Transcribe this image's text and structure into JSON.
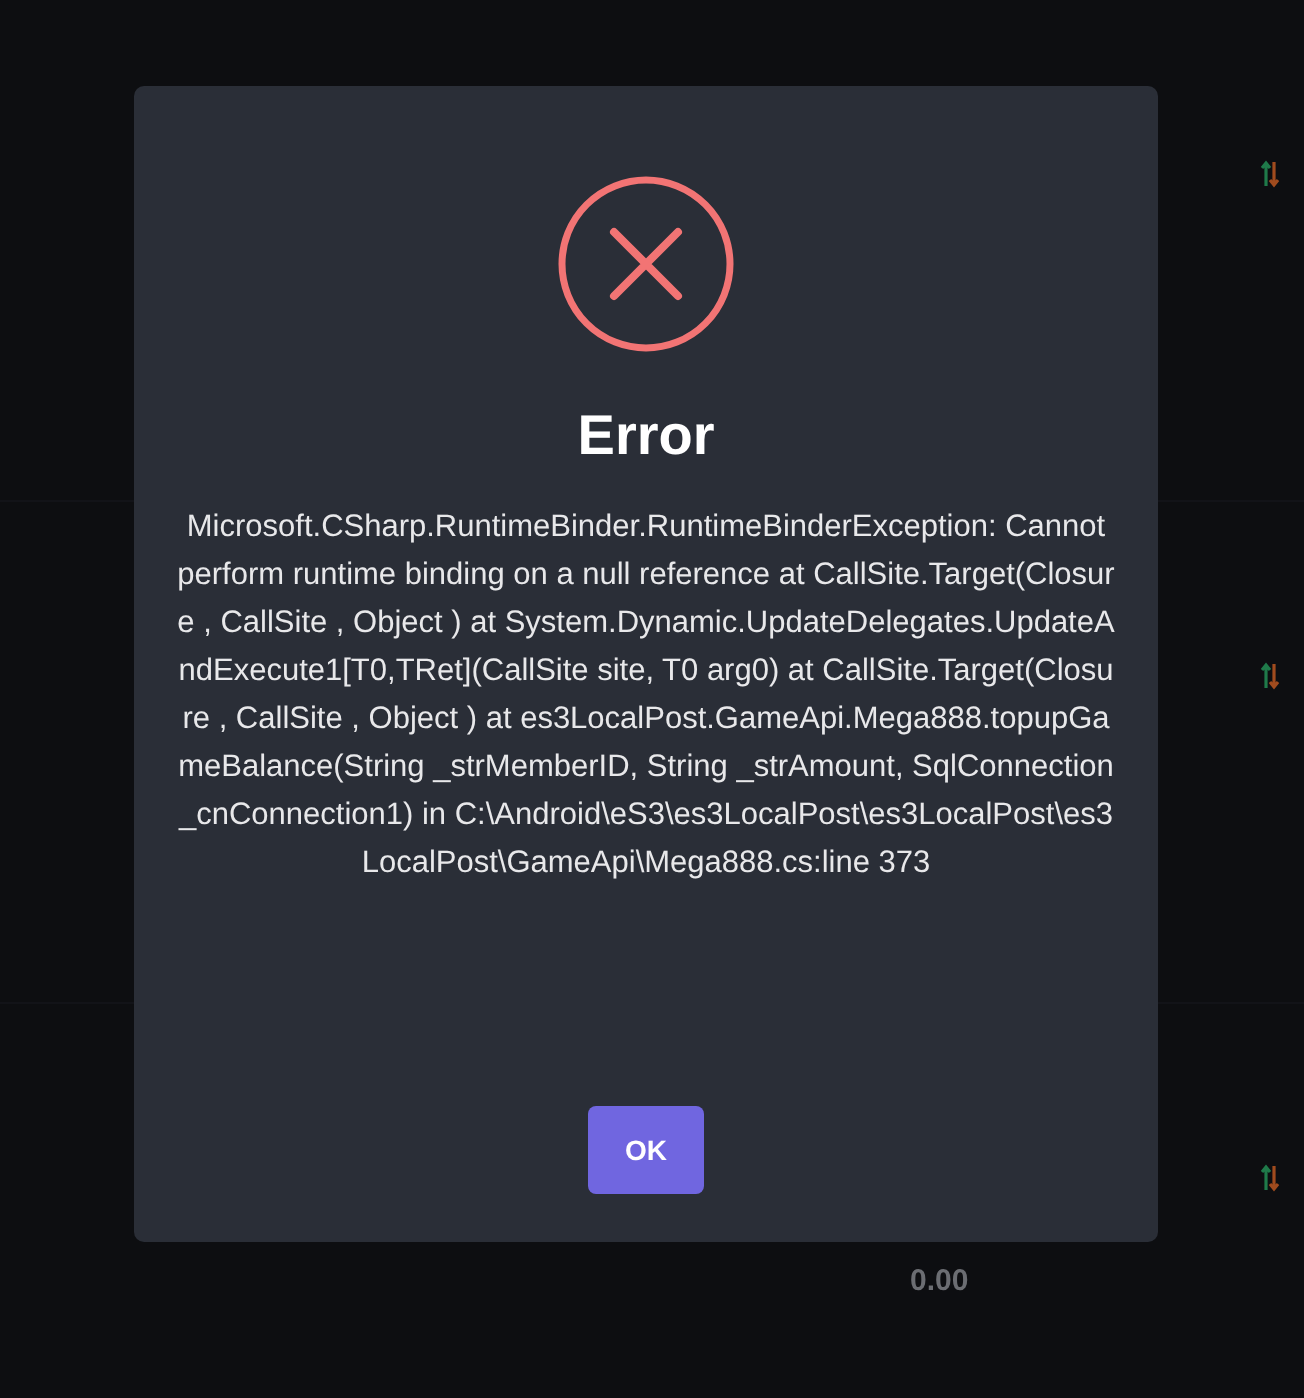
{
  "background": {
    "rows": [
      {
        "kind": "sort"
      },
      {
        "kind": "sort"
      },
      {
        "kind": "sort-amount",
        "amount": "0.00"
      }
    ]
  },
  "dialog": {
    "title": "Error",
    "message": "Microsoft.CSharp.RuntimeBinder.RuntimeBinderException: Cannot perform runtime binding on a null reference at CallSite.Target(Closure , CallSite , Object ) at System.Dynamic.UpdateDelegates.UpdateAndExecute1[T0,TRet](CallSite site, T0 arg0) at CallSite.Target(Closure , CallSite , Object ) at es3LocalPost.GameApi.Mega888.topupGameBalance(String _strMemberID, String _strAmount, SqlConnection _cnConnection1) in C:\\Android\\eS3\\es3LocalPost\\es3LocalPost\\es3LocalPost\\GameApi\\Mega888.cs:line 373",
    "button": "OK"
  }
}
